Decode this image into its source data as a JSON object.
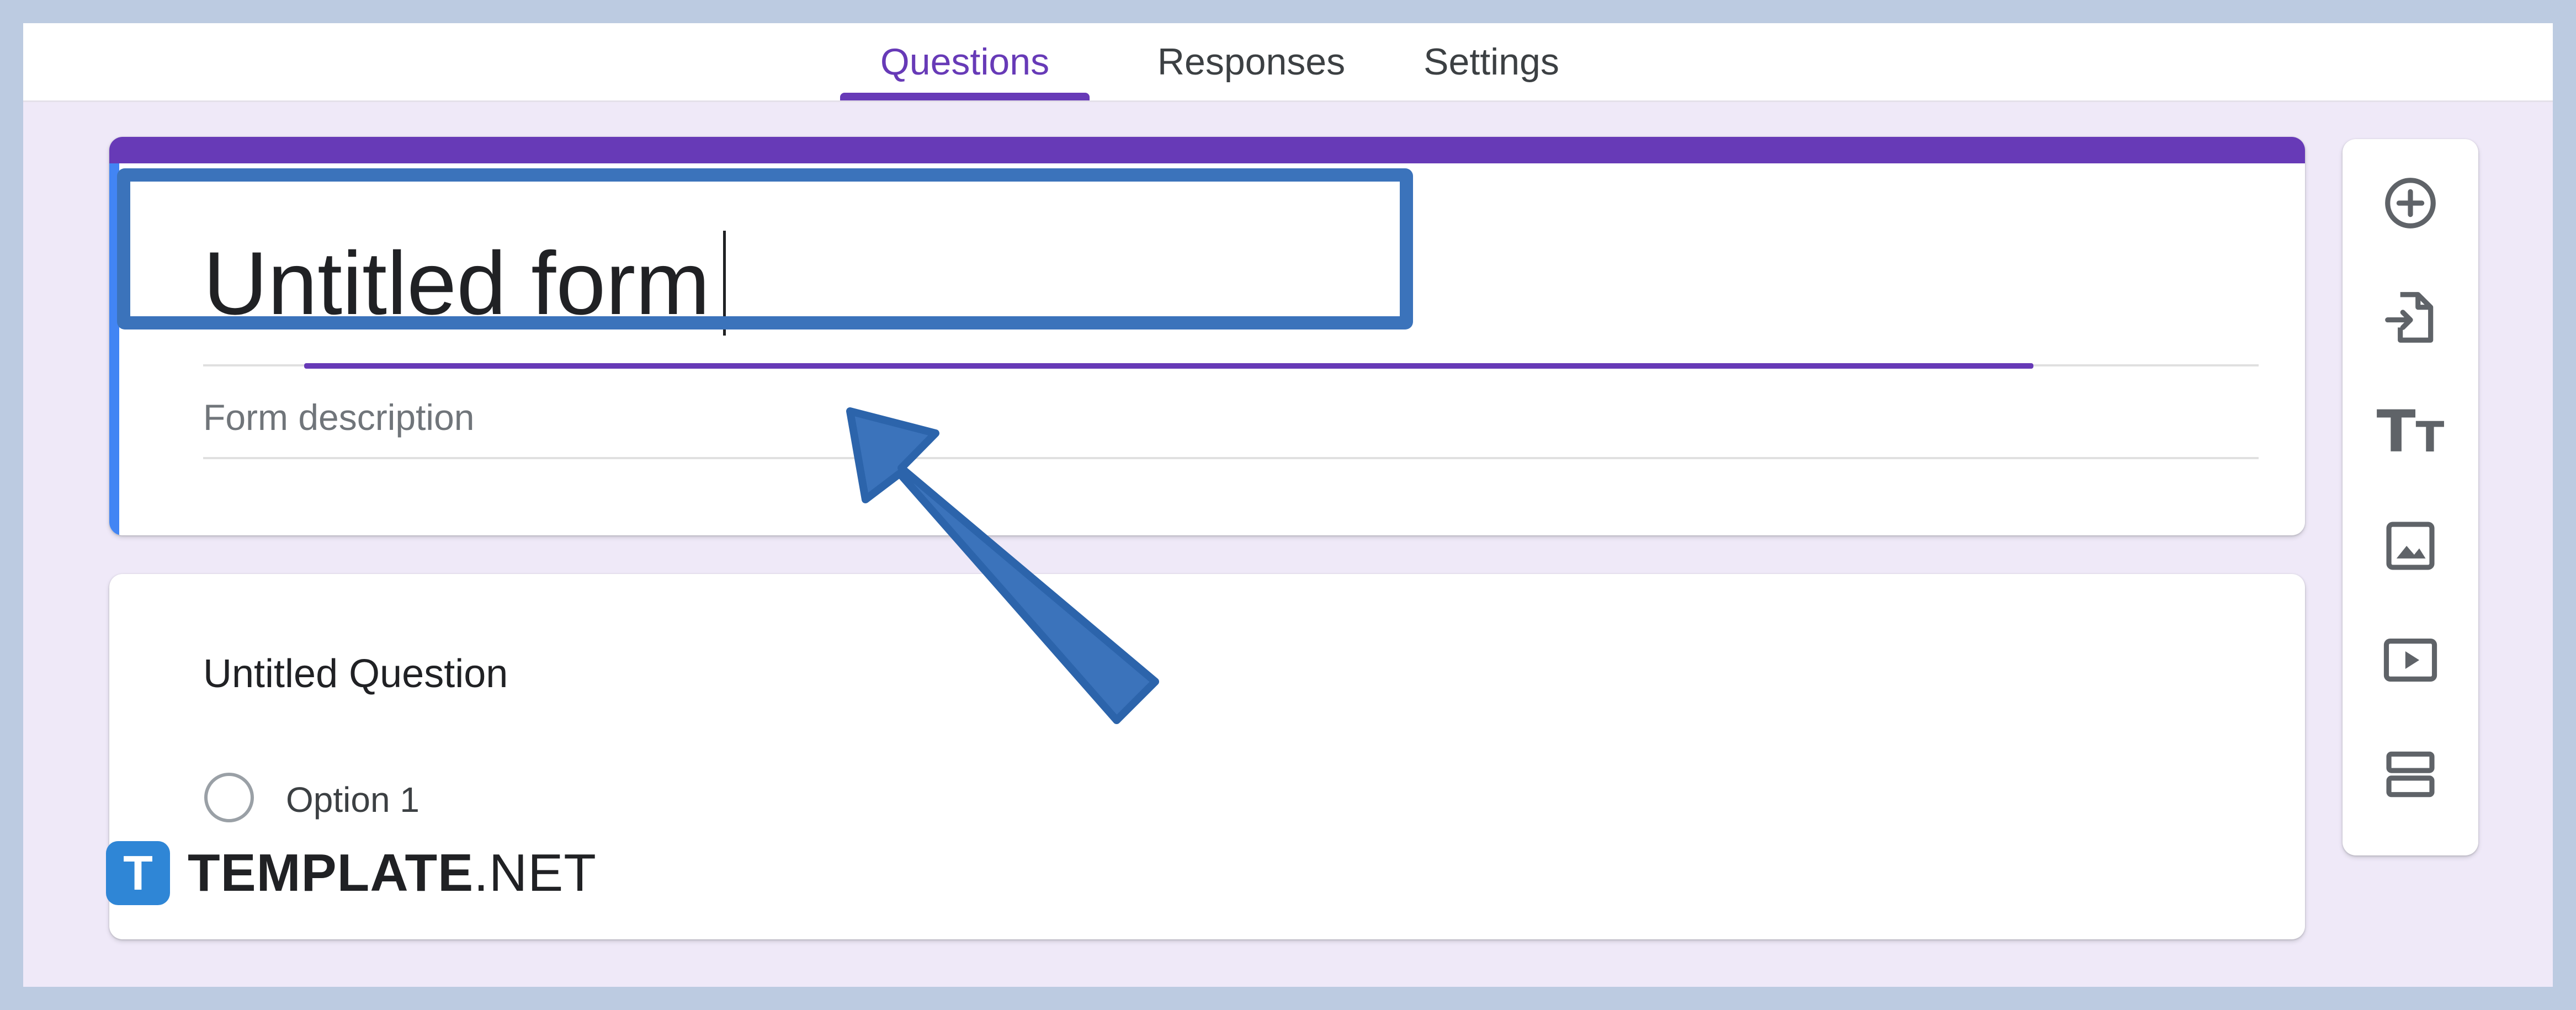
{
  "tabs": [
    {
      "label": "Questions",
      "active": true
    },
    {
      "label": "Responses",
      "active": false
    },
    {
      "label": "Settings",
      "active": false
    }
  ],
  "form": {
    "title": "Untitled form",
    "description_placeholder": "Form description"
  },
  "question": {
    "title": "Untitled Question",
    "options": [
      "Option 1"
    ]
  },
  "toolbar": {
    "items": [
      "add-question-icon",
      "import-questions-icon",
      "title-and-description-icon",
      "image-icon",
      "video-icon",
      "section-icon"
    ],
    "title_glyph_big": "T",
    "title_glyph_small": "T"
  },
  "watermark": {
    "badge": "T",
    "brand": "TEMPLATE",
    "suffix": ".NET"
  },
  "colors": {
    "accent": "#673ab7",
    "focus_bar": "#4285f4",
    "annotation": "#3b73bb",
    "page_background": "#efe9f8",
    "outer_border": "#bccbe1"
  }
}
